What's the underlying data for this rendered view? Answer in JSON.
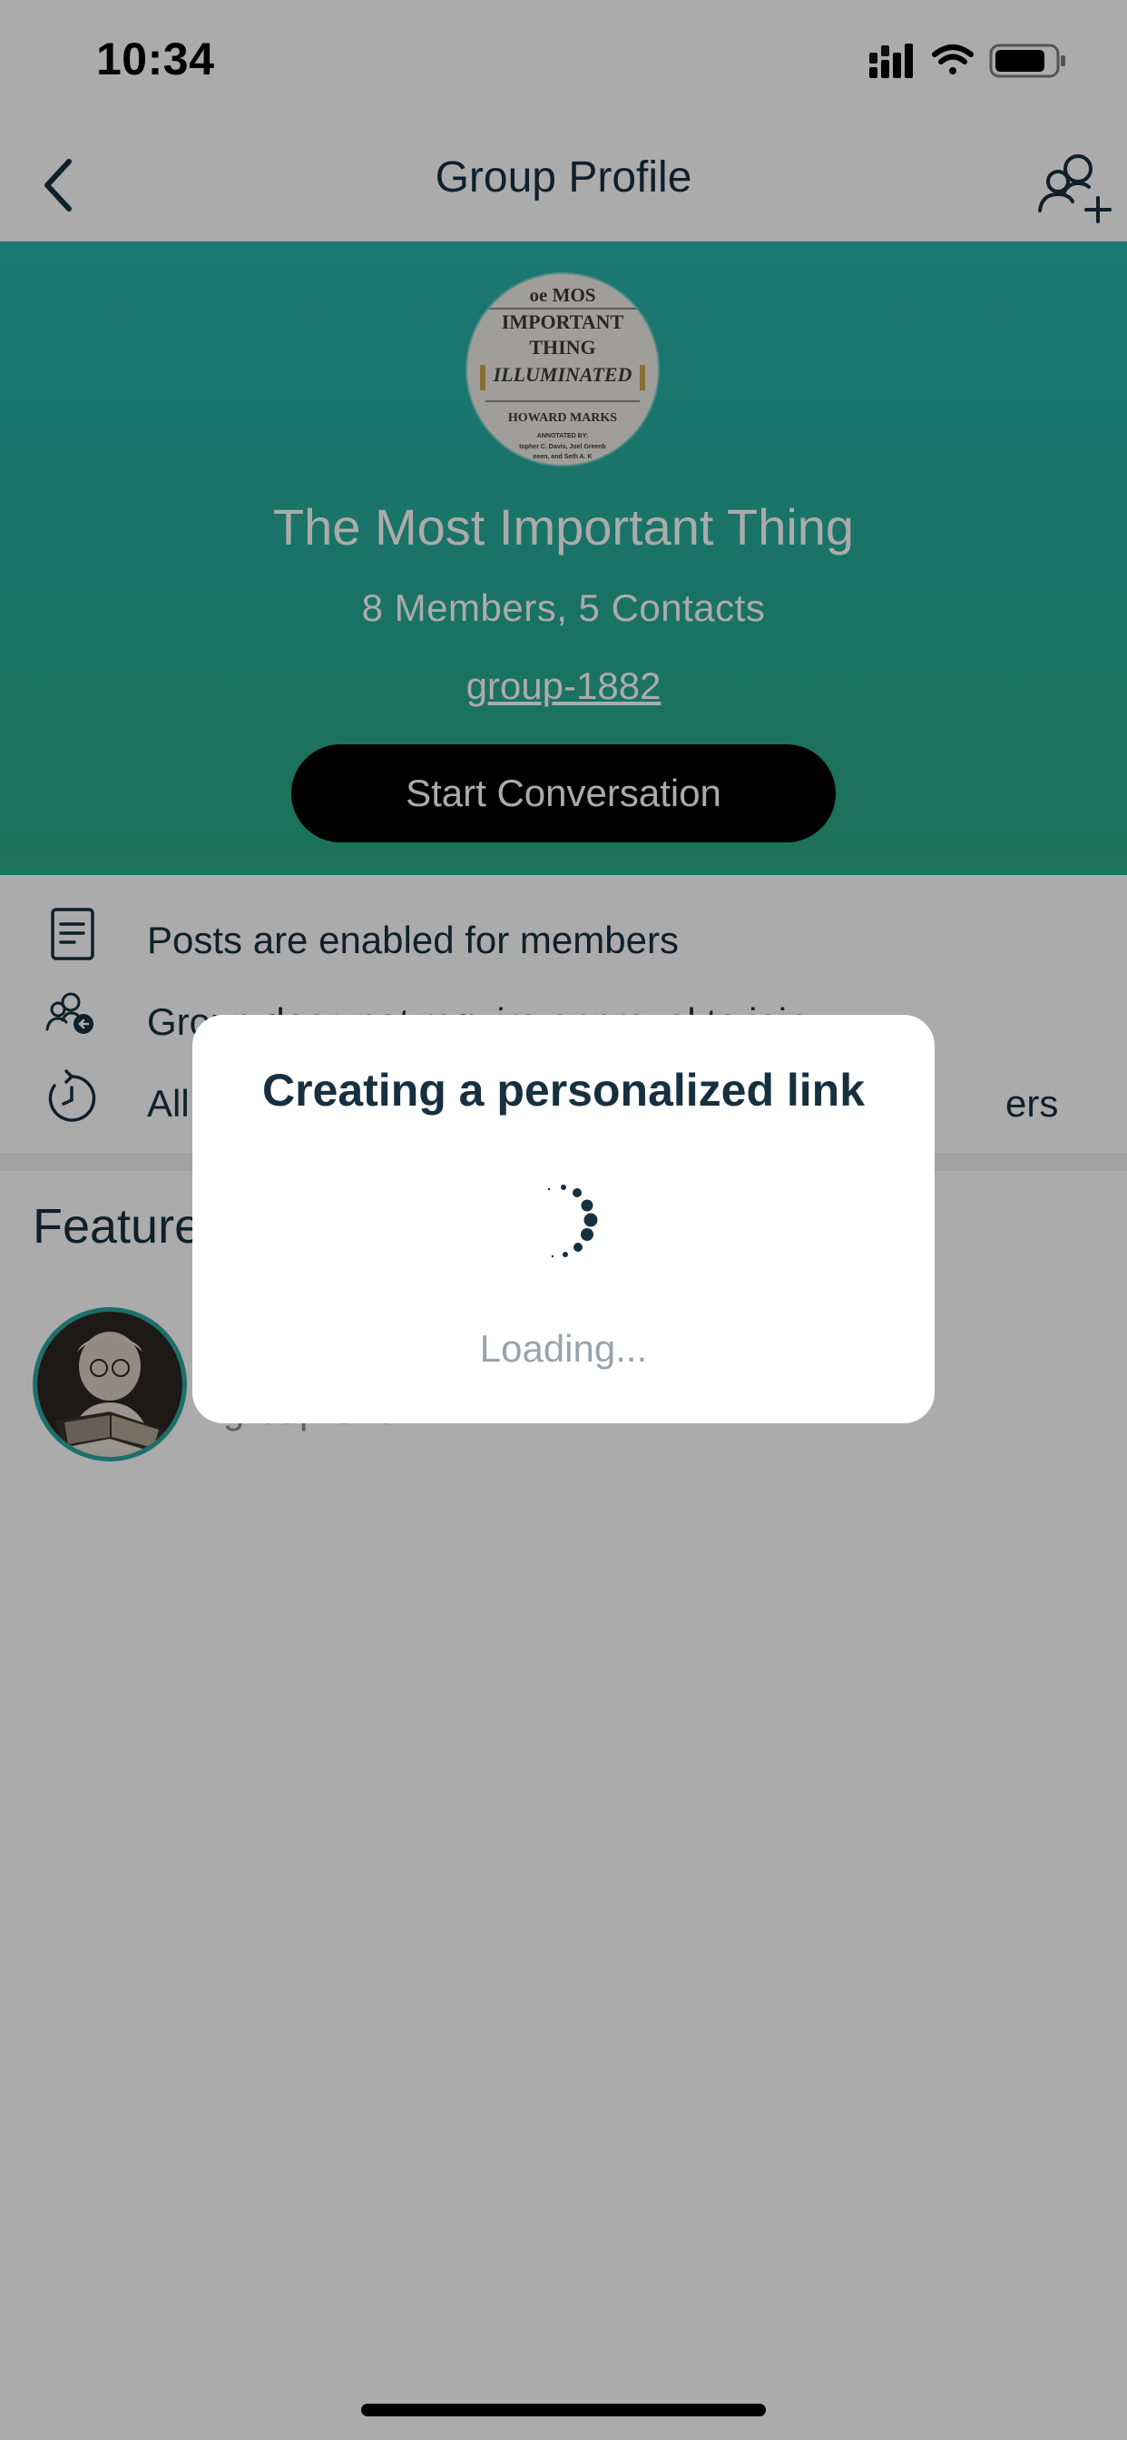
{
  "status_bar": {
    "time": "10:34"
  },
  "nav": {
    "title": "Group Profile",
    "back_icon": "chevron-left-icon",
    "action_icon": "add-member-icon"
  },
  "hero": {
    "avatar_lines": [
      "oe MOS",
      "IMPORTANT",
      "THING",
      "ILLUMINATED",
      "HOWARD MARKS",
      "ANNOTATED BY:",
      "topher C. Davis, Joel Greenb",
      "eeen, and Seth A. K"
    ],
    "group_name": "The Most Important Thing",
    "meta": "8 Members, 5 Contacts",
    "handle": "group-1882",
    "start_button": "Start Conversation",
    "gradient_top": "#2ab3aa",
    "gradient_bottom": "#2cab82"
  },
  "settings": [
    {
      "icon": "document-icon",
      "label": "Posts are enabled for members"
    },
    {
      "icon": "member-approval-icon",
      "label": "Group does not require approval to join"
    },
    {
      "icon": "history-clock-icon",
      "label_start": "All",
      "label_end": "ers"
    }
  ],
  "featured": {
    "title": "Feature",
    "item": {
      "handle": "group-320"
    }
  },
  "modal": {
    "title": "Creating a personalized link",
    "loading": "Loading..."
  }
}
